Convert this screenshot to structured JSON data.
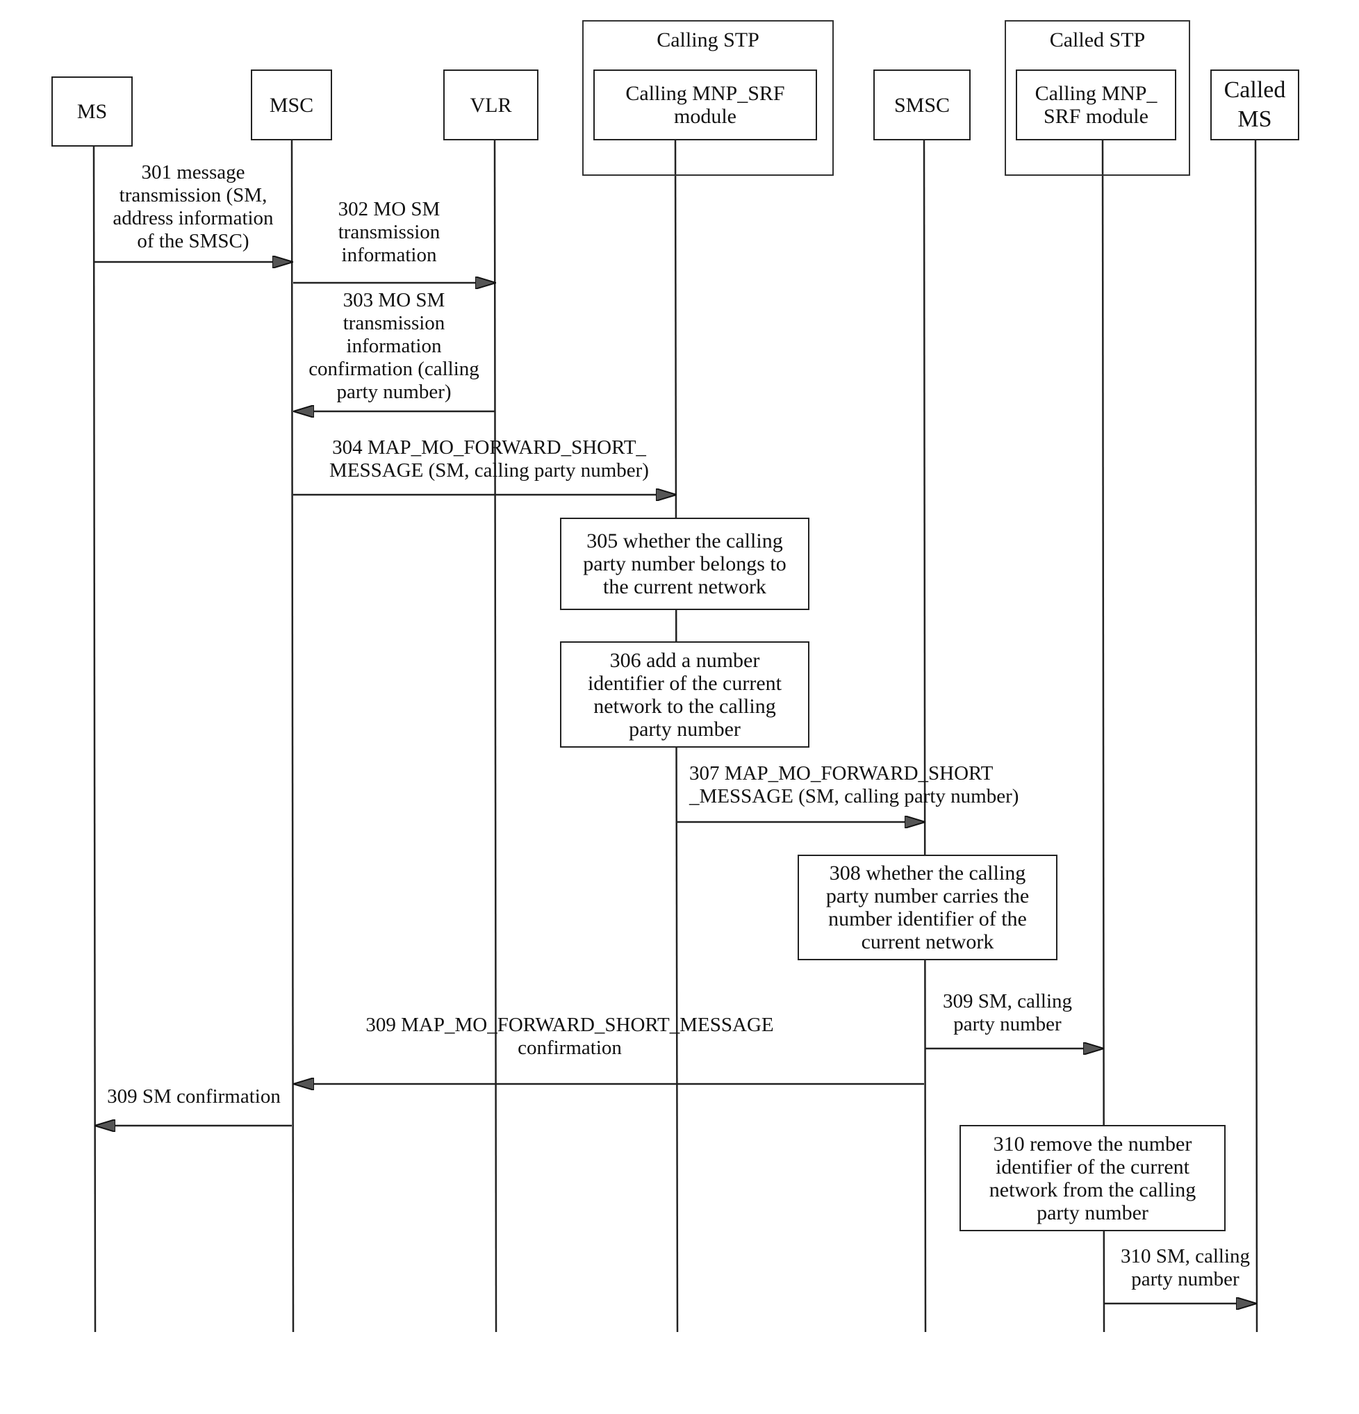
{
  "entities": {
    "ms": "MS",
    "msc": "MSC",
    "vlr": "VLR",
    "calling_stp": {
      "title": "Calling STP",
      "module": "Calling MNP_SRF\nmodule"
    },
    "smsc": "SMSC",
    "called_stp": {
      "title": "Called STP",
      "module": "Calling MNP_\nSRF module"
    },
    "called_ms": "Called\nMS"
  },
  "messages": [
    {
      "id": "301",
      "from": "MS",
      "to": "MSC",
      "label": "301 message\ntransmission (SM,\naddress information\nof the SMSC)"
    },
    {
      "id": "302",
      "from": "MSC",
      "to": "VLR",
      "label": "302 MO SM\ntransmission\ninformation"
    },
    {
      "id": "303",
      "from": "VLR",
      "to": "MSC",
      "label": "303 MO SM\ntransmission\ninformation\nconfirmation (calling\nparty number)"
    },
    {
      "id": "304",
      "from": "MSC",
      "to": "Calling MNP_SRF module",
      "label": "304 MAP_MO_FORWARD_SHORT_\nMESSAGE (SM, calling party number)"
    },
    {
      "id": "307",
      "from": "Calling MNP_SRF module",
      "to": "SMSC",
      "label": "307 MAP_MO_FORWARD_SHORT\n_MESSAGE (SM, calling party number)"
    },
    {
      "id": "309a",
      "from": "SMSC",
      "to": "Called MNP_SRF module",
      "label": "309 SM, calling\nparty number"
    },
    {
      "id": "309b",
      "from": "SMSC",
      "to": "MSC",
      "label": "309 MAP_MO_FORWARD_SHORT_MESSAGE\nconfirmation"
    },
    {
      "id": "309c",
      "from": "MSC",
      "to": "MS",
      "label": "309 SM confirmation"
    },
    {
      "id": "310",
      "from": "Called MNP_SRF module",
      "to": "Called MS",
      "label": "310 SM, calling\nparty number"
    }
  ],
  "steps": [
    {
      "id": "305",
      "label": "305 whether the calling\nparty number belongs to\nthe current network"
    },
    {
      "id": "306",
      "label": "306 add a number\nidentifier of the current\nnetwork to the calling\nparty number"
    },
    {
      "id": "308",
      "label": "308 whether the calling\nparty number carries the\nnumber identifier of the\ncurrent network"
    },
    {
      "id": "310",
      "label": "310 remove the number\nidentifier of the current\nnetwork from the calling\nparty number"
    }
  ]
}
